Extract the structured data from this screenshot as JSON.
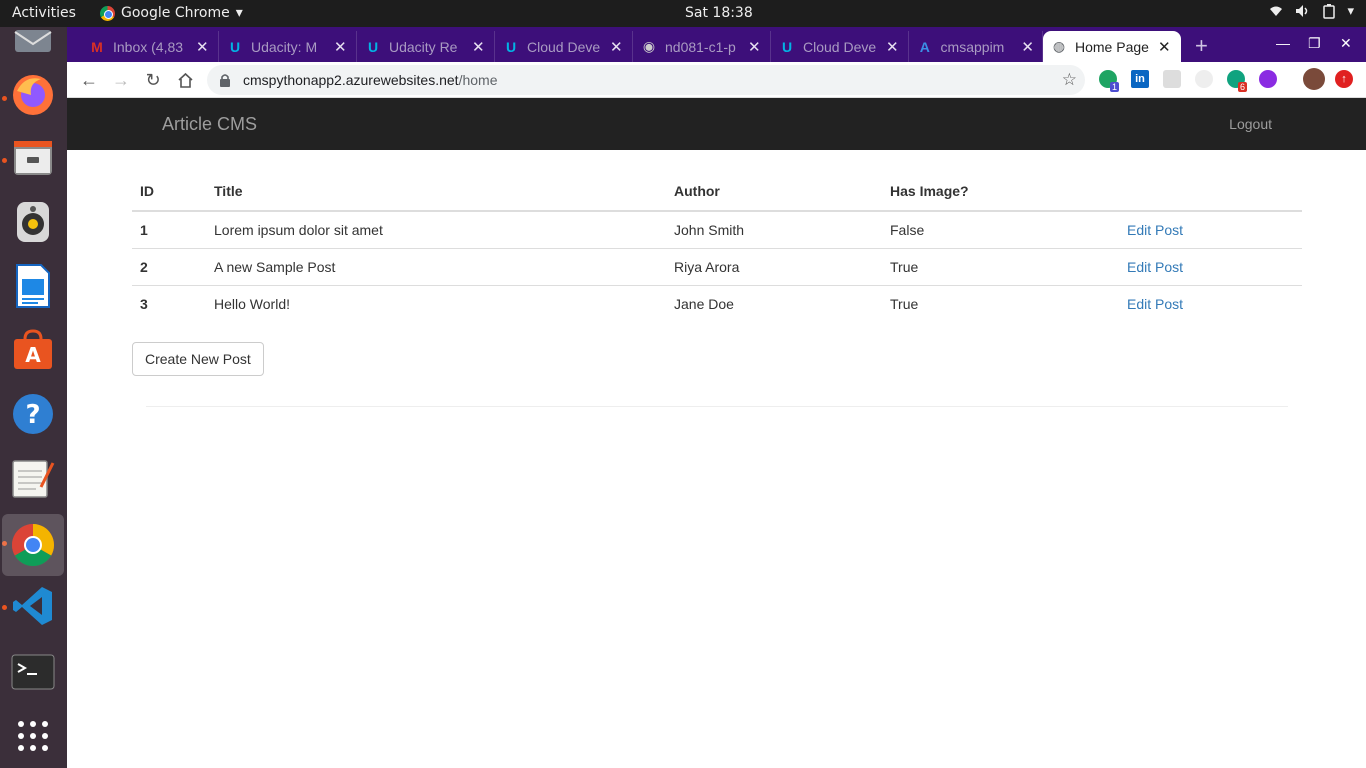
{
  "system": {
    "activities": "Activities",
    "app_menu": "Google Chrome",
    "clock": "Sat 18:38"
  },
  "tabs": [
    {
      "title": "Inbox (4,83",
      "icon": "gmail-icon",
      "color": "#d93025",
      "glyph": "M"
    },
    {
      "title": "Udacity: M",
      "icon": "udacity-icon",
      "color": "#02b3e4",
      "glyph": "U"
    },
    {
      "title": "Udacity Re",
      "icon": "udacity-icon",
      "color": "#02b3e4",
      "glyph": "U"
    },
    {
      "title": "Cloud Deve",
      "icon": "udacity-icon",
      "color": "#02b3e4",
      "glyph": "U"
    },
    {
      "title": "nd081-c1-p",
      "icon": "github-icon",
      "color": "#cccccc",
      "glyph": "◉"
    },
    {
      "title": "Cloud Deve",
      "icon": "udacity-icon",
      "color": "#02b3e4",
      "glyph": "U"
    },
    {
      "title": "cmsappim",
      "icon": "azure-icon",
      "color": "#0a7fd6",
      "glyph": "A"
    },
    {
      "title": "Home Page",
      "icon": "globe-icon",
      "color": "#5f6368",
      "glyph": "◍",
      "active": true
    }
  ],
  "omnibox": {
    "host": "cmspythonapp2.azurewebsites.net",
    "path": "/home"
  },
  "extensions": {
    "badge_1": "1",
    "badge_2": "6"
  },
  "page": {
    "brand": "Article CMS",
    "logout": "Logout",
    "table": {
      "headers": [
        "ID",
        "Title",
        "Author",
        "Has Image?",
        ""
      ],
      "rows": [
        {
          "id": "1",
          "title": "Lorem ipsum dolor sit amet",
          "author": "John Smith",
          "has_image": "False",
          "action": "Edit Post"
        },
        {
          "id": "2",
          "title": "A new Sample Post",
          "author": "Riya Arora",
          "has_image": "True",
          "action": "Edit Post"
        },
        {
          "id": "3",
          "title": "Hello World!",
          "author": "Jane Doe",
          "has_image": "True",
          "action": "Edit Post"
        }
      ]
    },
    "create_button": "Create New Post"
  },
  "colors": {
    "navbar": "#222222",
    "link": "#337ab7",
    "tabstrip": "#3d0f7a"
  }
}
